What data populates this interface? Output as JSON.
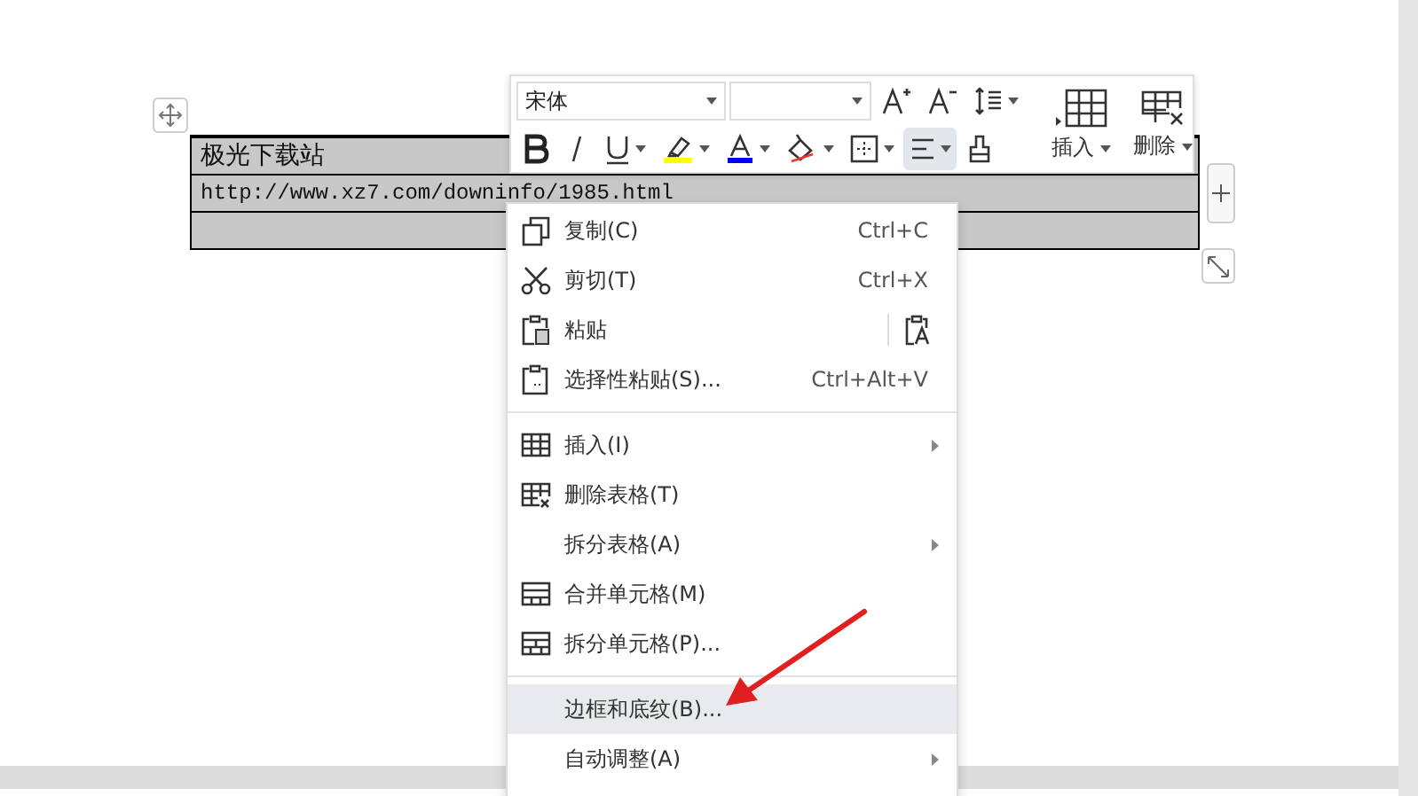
{
  "toolbar": {
    "font_name": "宋体",
    "format_buttons": [
      {
        "selected": false
      },
      {
        "selected": false
      },
      {
        "selected": false
      },
      {
        "selected": false,
        "color": "#ffff00"
      },
      {
        "selected": false,
        "color": "#0000ff"
      },
      {
        "selected": false
      },
      {
        "selected": false
      },
      {
        "selected": true
      },
      {
        "selected": false
      }
    ],
    "big_buttons": [
      {
        "label": "插入"
      },
      {
        "label": "删除"
      }
    ]
  },
  "table": {
    "rows": [
      {
        "kind": "text",
        "text": "极光下载站"
      },
      {
        "kind": "code",
        "text": "http://www.xz7.com/downinfo/1985.html"
      },
      {
        "kind": "empty"
      }
    ]
  },
  "context_menu": {
    "items": [
      {
        "kind": "item",
        "label": "复制(C)",
        "shortcut": "Ctrl+C",
        "submenu": false,
        "selected": false
      },
      {
        "kind": "item",
        "label": "剪切(T)",
        "shortcut": "Ctrl+X",
        "submenu": false,
        "selected": false
      },
      {
        "kind": "item",
        "label": "粘贴",
        "paste_option": true,
        "submenu": false,
        "selected": false
      },
      {
        "kind": "item",
        "label": "选择性粘贴(S)...",
        "shortcut": "Ctrl+Alt+V",
        "submenu": false,
        "selected": false
      },
      {
        "kind": "separator"
      },
      {
        "kind": "item",
        "label": "插入(I)",
        "submenu": true,
        "selected": false
      },
      {
        "kind": "item",
        "label": "删除表格(T)",
        "submenu": false,
        "selected": false
      },
      {
        "kind": "item",
        "label": "拆分表格(A)",
        "submenu": true,
        "selected": false
      },
      {
        "kind": "item",
        "label": "合并单元格(M)",
        "submenu": false,
        "selected": false
      },
      {
        "kind": "item",
        "label": "拆分单元格(P)...",
        "submenu": false,
        "selected": false
      },
      {
        "kind": "separator"
      },
      {
        "kind": "item",
        "label": "边框和底纹(B)...",
        "submenu": false,
        "selected": true
      },
      {
        "kind": "item",
        "label": "自动调整(A)",
        "submenu": true,
        "selected": false
      }
    ]
  }
}
